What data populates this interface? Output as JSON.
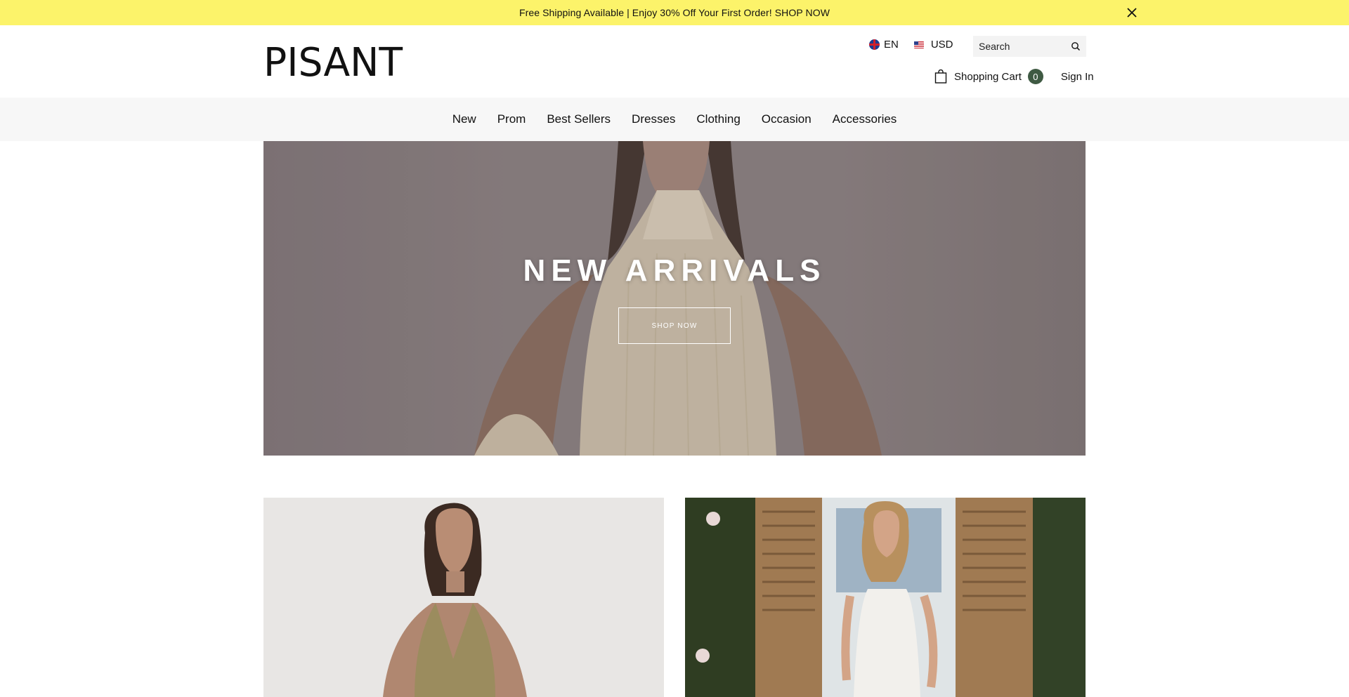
{
  "announcement": {
    "text": "Free Shipping Available | Enjoy 30% Off Your First Order!  SHOP NOW"
  },
  "header": {
    "logo_text": "PISANT",
    "language": "EN",
    "currency": "USD",
    "search_placeholder": "Search",
    "cart_label": "Shopping Cart",
    "cart_count": "0",
    "signin_label": "Sign In"
  },
  "nav": {
    "items": [
      "New",
      "Prom",
      "Best Sellers",
      "Dresses",
      "Clothing",
      "Occasion",
      "Accessories"
    ]
  },
  "hero": {
    "title": "NEW ARRIVALS",
    "button_label": "SHOP NOW"
  },
  "colors": {
    "announcement_bg": "#fcf36a",
    "cart_badge": "#3f5a43",
    "nav_bg": "#f7f7f7"
  },
  "icons": [
    "close-icon",
    "uk-flag-icon",
    "us-flag-icon",
    "search-icon",
    "shopping-bag-icon"
  ]
}
